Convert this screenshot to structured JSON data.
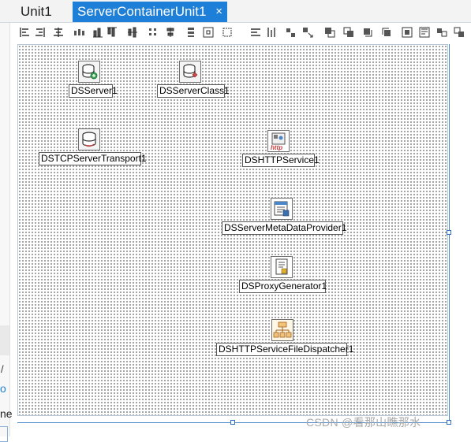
{
  "tabs": [
    {
      "label": "Unit1",
      "active": false
    },
    {
      "label": "ServerContainerUnit1",
      "active": true,
      "close": "×"
    }
  ],
  "colors": {
    "accent": "#1e7fd8",
    "surface_dots": "#2b2b2b",
    "selection": "#2f6fbf"
  },
  "toolbar_icons": [
    "align-left-icon",
    "align-right-icon",
    "align-center-horizontal-icon",
    "space-equal-horizontal-icon",
    "align-bottom-icon",
    "align-top-icon",
    "align-middle-icon",
    "align-to-grid-icon",
    "align-center-vertical-icon",
    "space-equal-vertical-icon",
    "center-in-window-icon",
    "size-to-grid-icon",
    "same-width-icon",
    "same-height-icon",
    "same-size-icon",
    "grow-icon",
    "bring-to-front-icon",
    "send-to-back-icon",
    "forward-one-icon",
    "backward-one-icon",
    "tab-order-icon",
    "creation-order-icon",
    "flip-children-icon",
    "lock-controls-icon"
  ],
  "components": [
    {
      "label": "DSServer1",
      "icon": "database-server-icon"
    },
    {
      "label": "DSServerClass1",
      "icon": "database-class-icon"
    },
    {
      "label": "DSTCPServerTransport1",
      "icon": "tcp-transport-icon"
    },
    {
      "label": "DSHTTPService1",
      "icon": "http-service-icon",
      "icon_text": "http"
    },
    {
      "label": "DSServerMetaDataProvider1",
      "icon": "metadata-provider-icon"
    },
    {
      "label": "DSProxyGenerator1",
      "icon": "proxy-generator-icon"
    },
    {
      "label": "DSHTTPServiceFileDispatcher1",
      "icon": "file-dispatcher-icon"
    }
  ],
  "left_panel": {
    "link_fragment": "o",
    "text_fragment": "ne",
    "slash": "/"
  },
  "watermark": "CSDN @看那山瞧那水"
}
